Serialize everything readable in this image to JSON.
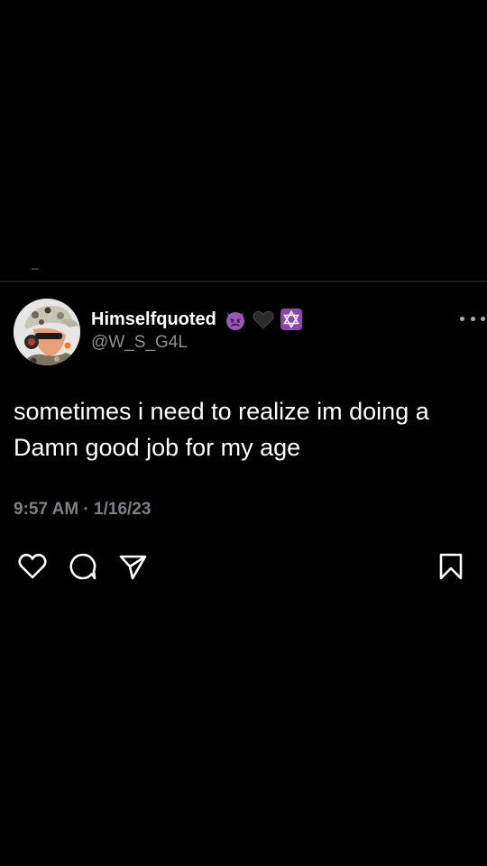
{
  "tweet": {
    "display_name": "Himselfquoted",
    "handle": "@W_S_G4L",
    "badges": [
      "smiling-imp-emoji",
      "black-heart-emoji",
      "star-of-david-emoji"
    ],
    "text": "sometimes i need to realize im doing a Damn good job for my age",
    "timestamp": "9:57 AM · 1/16/23"
  },
  "actions": [
    "heart-icon",
    "reply-icon",
    "share-icon",
    "bookmark-icon"
  ],
  "colors": {
    "background": "#000000",
    "text": "#ffffff",
    "secondary_text": "#8b8f93",
    "badge_purple": "#8e44ad"
  }
}
